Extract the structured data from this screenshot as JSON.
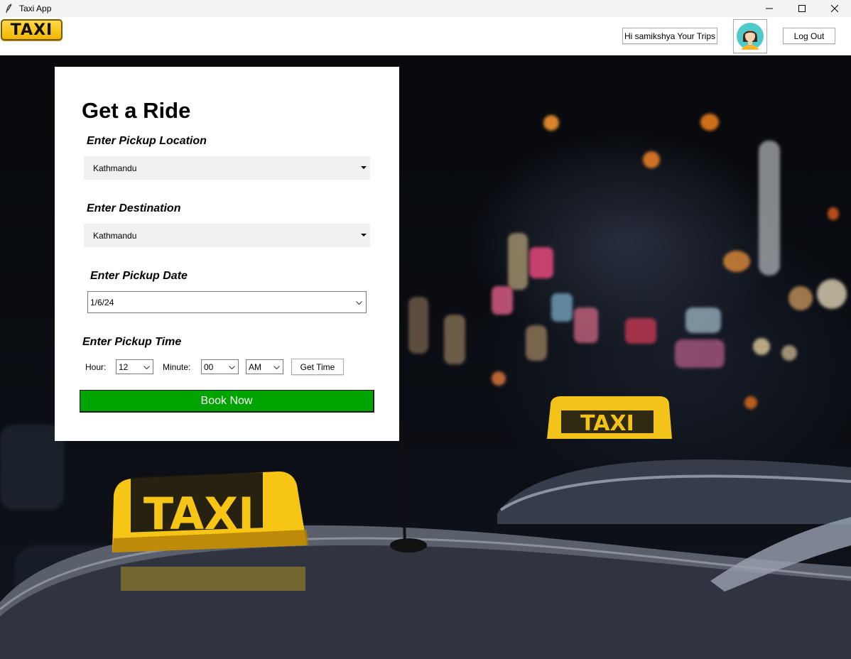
{
  "window": {
    "title": "Taxi App"
  },
  "header": {
    "logo_text": "TAXI",
    "greeting": "Hi samikshya Your Trips",
    "logout_label": "Log Out"
  },
  "form": {
    "heading": "Get a Ride",
    "pickup_label": "Enter Pickup Location",
    "pickup_value": "Kathmandu",
    "destination_label": "Enter Destination",
    "destination_value": "Kathmandu",
    "date_label": "Enter Pickup Date",
    "date_value": "1/6/24",
    "time_label": "Enter Pickup Time",
    "hour_label": "Hour:",
    "hour_value": "12",
    "minute_label": "Minute:",
    "minute_value": "00",
    "ampm_value": "AM",
    "get_time_label": "Get Time",
    "book_label": "Book Now"
  },
  "background": {
    "taxi_sign_near": "TAXI",
    "taxi_sign_far": "TAXI"
  },
  "colors": {
    "book_button": "#00a400",
    "taxi_yellow": "#f5c400"
  }
}
